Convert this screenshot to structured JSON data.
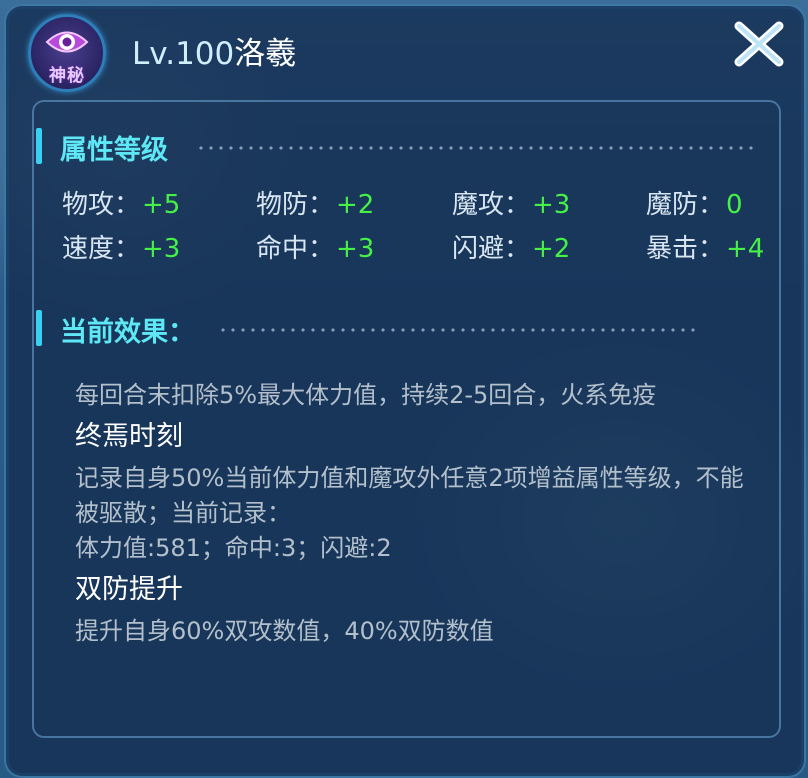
{
  "header": {
    "rarity_label": "神秘",
    "level": "Lv.100",
    "name": "洛羲"
  },
  "attr_section": {
    "title": "属性等级",
    "stats": [
      {
        "label": "物攻：",
        "value": "+5"
      },
      {
        "label": "物防：",
        "value": "+2"
      },
      {
        "label": "魔攻：",
        "value": "+3"
      },
      {
        "label": "魔防：",
        "value": "0"
      },
      {
        "label": "速度：",
        "value": "+3"
      },
      {
        "label": "命中：",
        "value": "+3"
      },
      {
        "label": "闪避：",
        "value": "+2"
      },
      {
        "label": "暴击：",
        "value": "+4"
      }
    ]
  },
  "effect_section": {
    "title": "当前效果：",
    "base_effect": "每回合末扣除5%最大体力值，持续2-5回合，火系免疫",
    "effects": [
      {
        "name": "终焉时刻",
        "lines": [
          "记录自身50%当前体力值和魔攻外任意2项增益属性等级，不能被驱散；当前记录：",
          "体力值:581；命中:3；闪避:2"
        ]
      },
      {
        "name": "双防提升",
        "lines": [
          "提升自身60%双攻数值，40%双防数值"
        ]
      }
    ]
  },
  "icons": {
    "rarity": "eye-icon",
    "close": "close-icon"
  },
  "colors": {
    "accent": "#5ee8f5",
    "stat_value": "#46f046",
    "effect_name": "#ffffff",
    "effect_text": "#b3c0cc"
  }
}
